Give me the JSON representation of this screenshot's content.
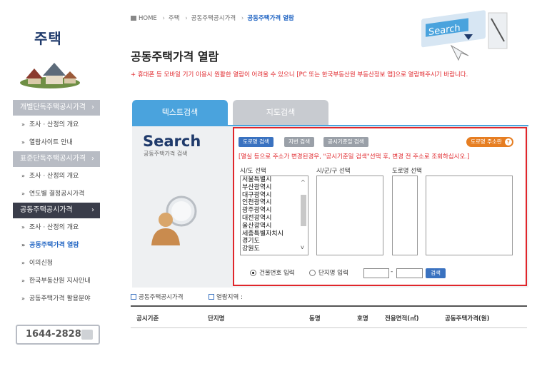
{
  "sidebar": {
    "title": "주택",
    "menu": [
      {
        "type": "cat",
        "label": "개별단독주택공시가격",
        "arrow": "›"
      },
      {
        "type": "sub",
        "label": "조사 · 산정의 개요"
      },
      {
        "type": "sub",
        "label": "열람사이트 안내"
      },
      {
        "type": "cat",
        "label": "표준단독주택공시가격",
        "arrow": "›"
      },
      {
        "type": "sub",
        "label": "조사 · 산정의 개요"
      },
      {
        "type": "sub",
        "label": "연도별 결정공시가격"
      },
      {
        "type": "cat-active",
        "label": "공동주택공시가격",
        "arrow": "›"
      },
      {
        "type": "sub",
        "label": "조사 · 산정의 개요"
      },
      {
        "type": "sub-current",
        "label": "공동주택가격 열람"
      },
      {
        "type": "sub",
        "label": "이의신청"
      },
      {
        "type": "sub",
        "label": "한국부동산원 지사안내"
      },
      {
        "type": "sub",
        "label": "공동주택가격 활용분야"
      }
    ],
    "phone": "1644-2828"
  },
  "breadcrumb": {
    "home": "HOME",
    "l1": "주택",
    "l2": "공동주택공시가격",
    "current": "공동주택가격 열람"
  },
  "page_title": "공동주택가격 열람",
  "notice": "+ 휴대폰 등 모바일 기기 이용시 원활한 열람이 어려울 수 있으니 [PC 또는 한국부동산원 부동산정보 앱]으로 열람해주시기 바랍니다.",
  "header_illustration_text": "Search",
  "tabs": {
    "text": "텍스트검색",
    "map": "지도검색"
  },
  "search_logo": "Search",
  "search_logo_sub": "공동주택가격 검색",
  "search": {
    "mode_buttons": {
      "road": "도로명 검색",
      "lot": "지번 검색",
      "base_date": "공시기준일 검색"
    },
    "help_button": "도로명 주소란",
    "help_icon": "?",
    "guide": "[멸실 등으로 주소가 변경된경우, \"공시기준일 검색\"선택 후, 변경 전 주소로 조회하십시오.]",
    "labels": {
      "sido": "시/도 선택",
      "sigungu": "시/군/구 선택",
      "road": "도로명 선택"
    },
    "sido_options": [
      "서울특별시",
      "부산광역시",
      "대구광역시",
      "인천광역시",
      "광주광역시",
      "대전광역시",
      "울산광역시",
      "세종특별자치시",
      "경기도",
      "강원도"
    ],
    "radio_building": "건물번호 입력",
    "radio_complex": "단지명 입력",
    "dash": "-",
    "go_button": "검색"
  },
  "info": {
    "base": "공동주택공시가격",
    "area": "열람지역 :"
  },
  "table_headers": [
    "공시기준",
    "단지명",
    "동명",
    "호명",
    "전용면적(㎡)",
    "공동주택가격(원)"
  ],
  "colors": {
    "accent_blue": "#4aa3dd",
    "button_blue": "#3a72c0",
    "alert_red": "#e0262b",
    "orange": "#e67e22",
    "nav_dark": "#3a3d4a"
  }
}
